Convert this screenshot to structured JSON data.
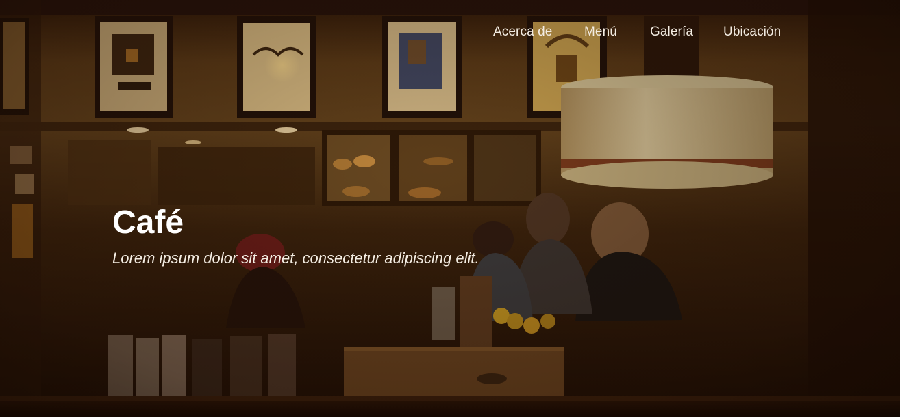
{
  "nav": {
    "items": [
      {
        "label": "Acerca de"
      },
      {
        "label": "Menú"
      },
      {
        "label": "Galería"
      },
      {
        "label": "Ubicación"
      }
    ]
  },
  "hero": {
    "title": "Café",
    "tagline": "Lorem ipsum dolor sit amet, consectetur adipiscing elit."
  },
  "colors": {
    "text": "#ffffff",
    "overlay": "#1b0d05",
    "warm_light": "#c79a4c"
  }
}
